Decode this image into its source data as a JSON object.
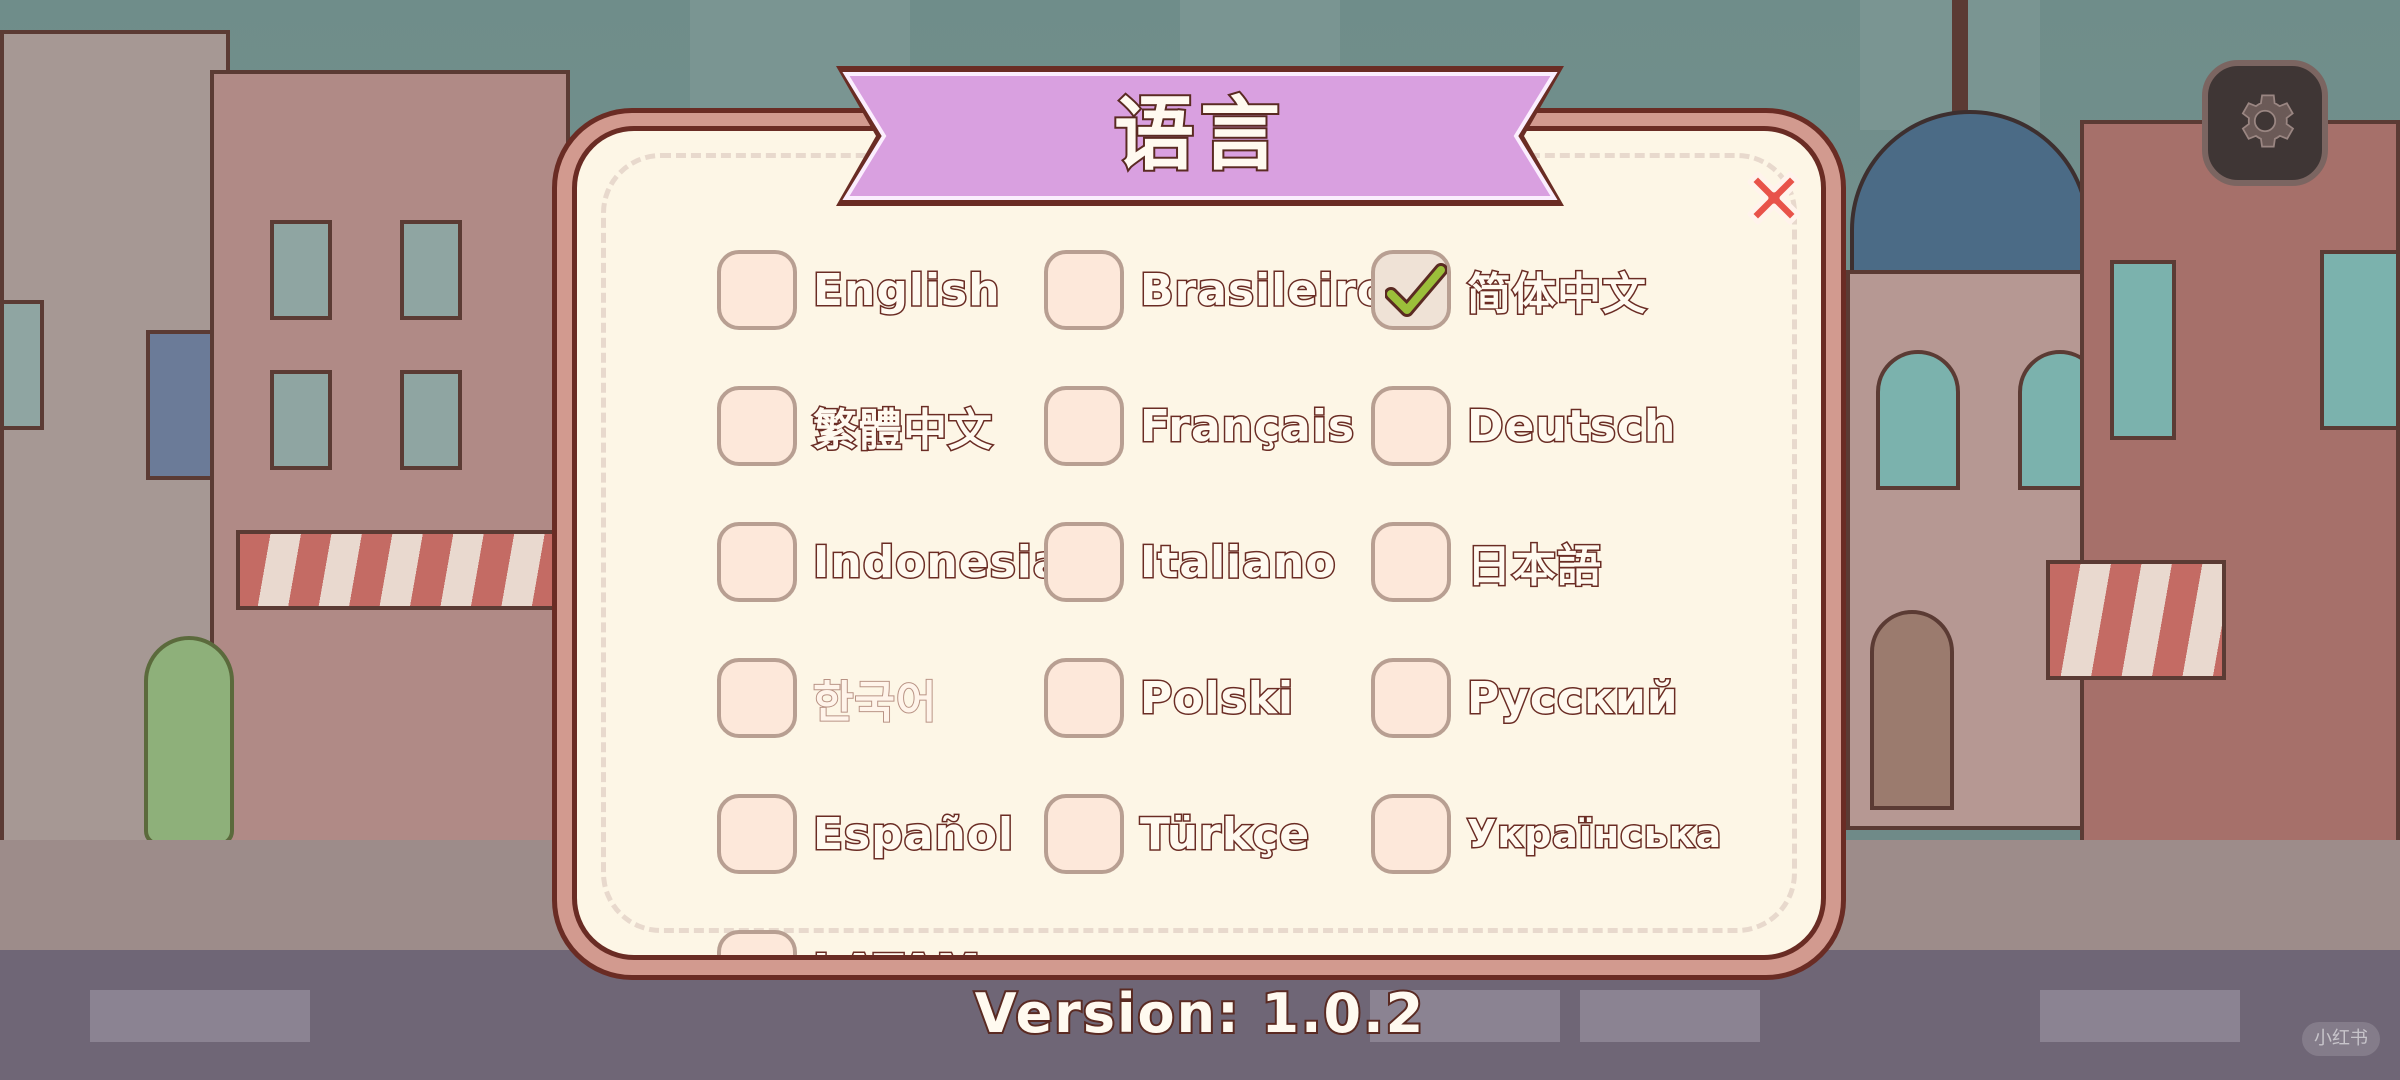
{
  "dialog": {
    "title": "语言",
    "selected": "简体中文",
    "options": [
      {
        "label": "English",
        "checked": false
      },
      {
        "label": "Brasileiro",
        "checked": false
      },
      {
        "label": "简体中文",
        "checked": true
      },
      {
        "label": "繁體中文",
        "checked": false
      },
      {
        "label": "Français",
        "checked": false
      },
      {
        "label": "Deutsch",
        "checked": false
      },
      {
        "label": "Indonesia",
        "checked": false
      },
      {
        "label": "Italiano",
        "checked": false
      },
      {
        "label": "日本語",
        "checked": false
      },
      {
        "label": "한국어",
        "checked": false
      },
      {
        "label": "Polski",
        "checked": false
      },
      {
        "label": "Русский",
        "checked": false
      },
      {
        "label": "Español",
        "checked": false
      },
      {
        "label": "Türkçe",
        "checked": false
      },
      {
        "label": "Українська",
        "checked": false
      },
      {
        "label": "LATAM",
        "checked": false
      }
    ]
  },
  "footer": {
    "version": "Version:  1.0.2"
  },
  "watermark": "小红书",
  "icons": {
    "settings": "gear-icon",
    "close": "close-icon",
    "check": "checkmark-icon"
  },
  "colors": {
    "banner": "#d9a0e0",
    "panel": "#fdf6e6",
    "close": "#e8524a",
    "check": "#9bbf3a"
  }
}
